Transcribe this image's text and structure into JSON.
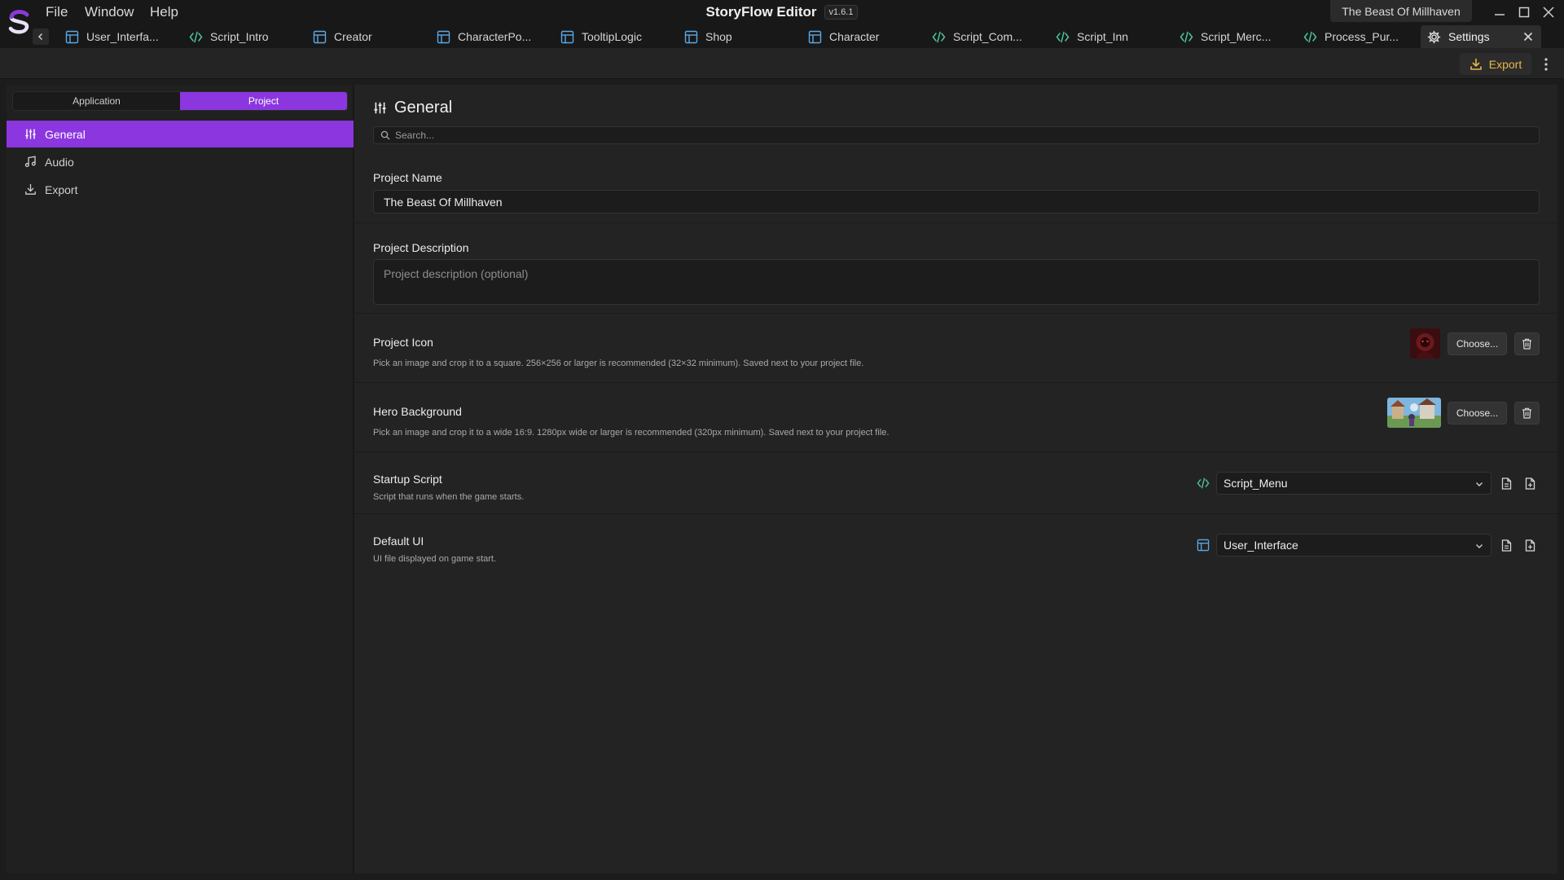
{
  "app": {
    "title": "StoryFlow Editor",
    "version": "v1.6.1",
    "project_name": "The Beast Of Millhaven"
  },
  "menu": [
    "File",
    "Window",
    "Help"
  ],
  "tabs": [
    {
      "label": "User_Interfa...",
      "icon": "layout-icon"
    },
    {
      "label": "Script_Intro",
      "icon": "code-icon"
    },
    {
      "label": "Creator",
      "icon": "layout-icon"
    },
    {
      "label": "CharacterPo...",
      "icon": "layout-icon"
    },
    {
      "label": "TooltipLogic",
      "icon": "layout-icon"
    },
    {
      "label": "Shop",
      "icon": "layout-icon"
    },
    {
      "label": "Character",
      "icon": "layout-icon"
    },
    {
      "label": "Script_Com...",
      "icon": "code-icon"
    },
    {
      "label": "Script_Inn",
      "icon": "code-icon"
    },
    {
      "label": "Script_Merc...",
      "icon": "code-icon"
    },
    {
      "label": "Process_Pur...",
      "icon": "code-icon"
    },
    {
      "label": "Settings",
      "icon": "gear-icon",
      "active": true
    }
  ],
  "toolbar": {
    "export_label": "Export"
  },
  "sidebar": {
    "scope": [
      "Application",
      "Project"
    ],
    "scope_selected": "Project",
    "items": [
      {
        "label": "General",
        "icon": "sliders-icon",
        "active": true
      },
      {
        "label": "Audio",
        "icon": "music-icon"
      },
      {
        "label": "Export",
        "icon": "download-icon"
      }
    ]
  },
  "main": {
    "title": "General",
    "search_placeholder": "Search...",
    "project_name": {
      "label": "Project Name",
      "value": "The Beast Of Millhaven"
    },
    "project_description": {
      "label": "Project Description",
      "placeholder": "Project description (optional)"
    },
    "project_icon": {
      "label": "Project Icon",
      "description": "Pick an image and crop it to a square. 256×256 or larger is recommended (32×32 minimum). Saved next to your project file.",
      "choose_label": "Choose..."
    },
    "hero_background": {
      "label": "Hero Background",
      "description": "Pick an image and crop it to a wide 16:9. 1280px wide or larger is recommended (320px minimum). Saved next to your project file.",
      "choose_label": "Choose..."
    },
    "startup_script": {
      "label": "Startup Script",
      "description": "Script that runs when the game starts.",
      "value": "Script_Menu"
    },
    "default_ui": {
      "label": "Default UI",
      "description": "UI file displayed on game start.",
      "value": "User_Interface"
    }
  },
  "colors": {
    "accent": "#8b36df",
    "export": "#e8b64a",
    "code_icon": "#4fc3a1",
    "layout_icon": "#5aa9e6"
  }
}
